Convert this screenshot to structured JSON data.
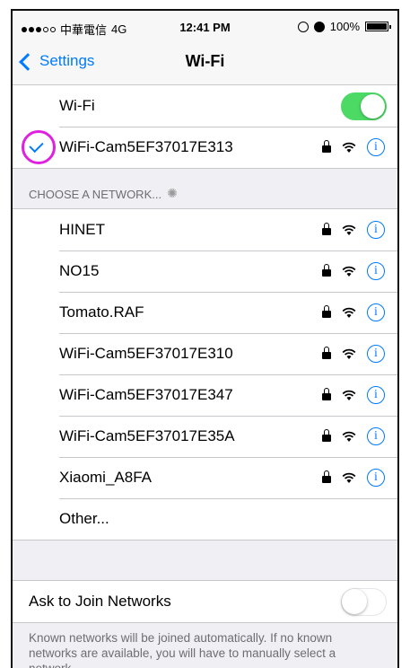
{
  "status": {
    "carrier": "中華電信",
    "network": "4G",
    "time": "12:41 PM",
    "battery": "100%"
  },
  "nav": {
    "back_label": "Settings",
    "title": "Wi-Fi"
  },
  "wifi_toggle": {
    "label": "Wi-Fi",
    "on": true
  },
  "connected": {
    "name": "WiFi-Cam5EF37017E313"
  },
  "section": {
    "header": "CHOOSE A NETWORK..."
  },
  "networks": [
    {
      "name": "HINET"
    },
    {
      "name": "NO15"
    },
    {
      "name": "Tomato.RAF"
    },
    {
      "name": "WiFi-Cam5EF37017E310"
    },
    {
      "name": "WiFi-Cam5EF37017E347"
    },
    {
      "name": "WiFi-Cam5EF37017E35A"
    },
    {
      "name": "Xiaomi_A8FA"
    }
  ],
  "other_label": "Other...",
  "ask_join": {
    "label": "Ask to Join Networks",
    "on": false
  },
  "footer_text": "Known networks will be joined automatically. If no known networks are available, you will have to manually select a network.",
  "colors": {
    "accent": "#007aff",
    "toggle_on": "#4cd964",
    "annotation": "#e020e0"
  }
}
